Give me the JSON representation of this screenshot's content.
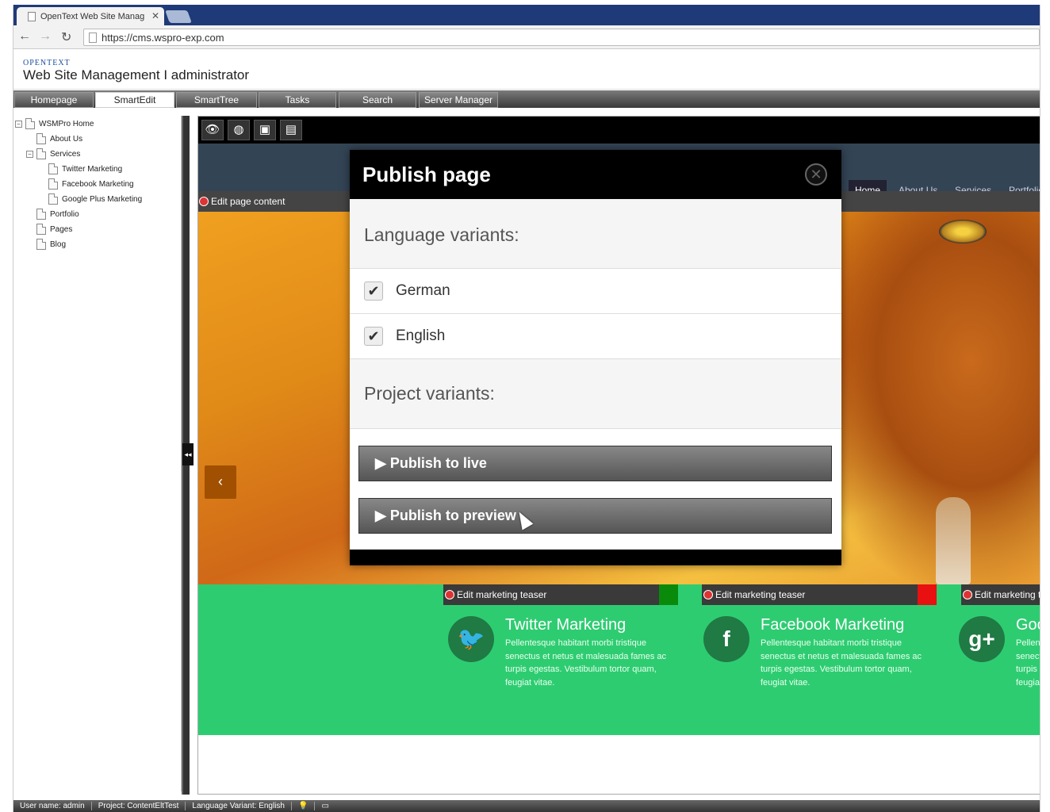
{
  "browser": {
    "tab_title": "OpenText Web Site Manag",
    "url": "https://cms.wspro-exp.com"
  },
  "app": {
    "brand_small": "OPENTEXT",
    "brand_title": "Web Site Management  I  administrator"
  },
  "menu": [
    "Homepage",
    "SmartEdit",
    "SmartTree",
    "Tasks",
    "Search",
    "Server Manager"
  ],
  "tree": {
    "root": "WSMPro Home",
    "about": "About Us",
    "services": "Services",
    "twitter": "Twitter Marketing",
    "facebook": "Facebook Marketing",
    "google": "Google Plus Marketing",
    "portfolio": "Portfolio",
    "pages": "Pages",
    "blog": "Blog"
  },
  "site": {
    "nav": [
      "Home",
      "About Us",
      "Services",
      "Portfolio"
    ],
    "edit_page": "Edit page content",
    "edit_teaser": "Edit marketing teaser",
    "edit_teaser_cut": "Edit marketing t"
  },
  "teasers": [
    {
      "title": "Twitter Marketing",
      "icon": "twitter-icon",
      "body": "Pellentesque habitant morbi tristique senectus et netus et malesuada fames ac turpis egestas. Vestibulum tortor quam, feugiat vitae."
    },
    {
      "title": "Facebook Marketing",
      "icon": "facebook-icon",
      "body": "Pellentesque habitant morbi tristique senectus et netus et malesuada fames ac turpis egestas. Vestibulum tortor quam, feugiat vitae."
    },
    {
      "title": "Goo",
      "icon": "google-plus-icon",
      "body": "Pellen senect turpis feugia"
    }
  ],
  "modal": {
    "title": "Publish page",
    "lang_header": "Language variants:",
    "lang_items": [
      "German",
      "English"
    ],
    "proj_header": "Project variants:",
    "publish_live": "Publish to live",
    "publish_preview": "Publish to preview"
  },
  "status": {
    "user": "User name: admin",
    "project": "Project: ContentEltTest",
    "language": "Language Variant: English"
  },
  "colors": {
    "menu_bg": "#4a4a4a",
    "green": "#2ecc71",
    "teaser_square_1": "#0a8a0a",
    "teaser_square_2": "#e81010"
  }
}
